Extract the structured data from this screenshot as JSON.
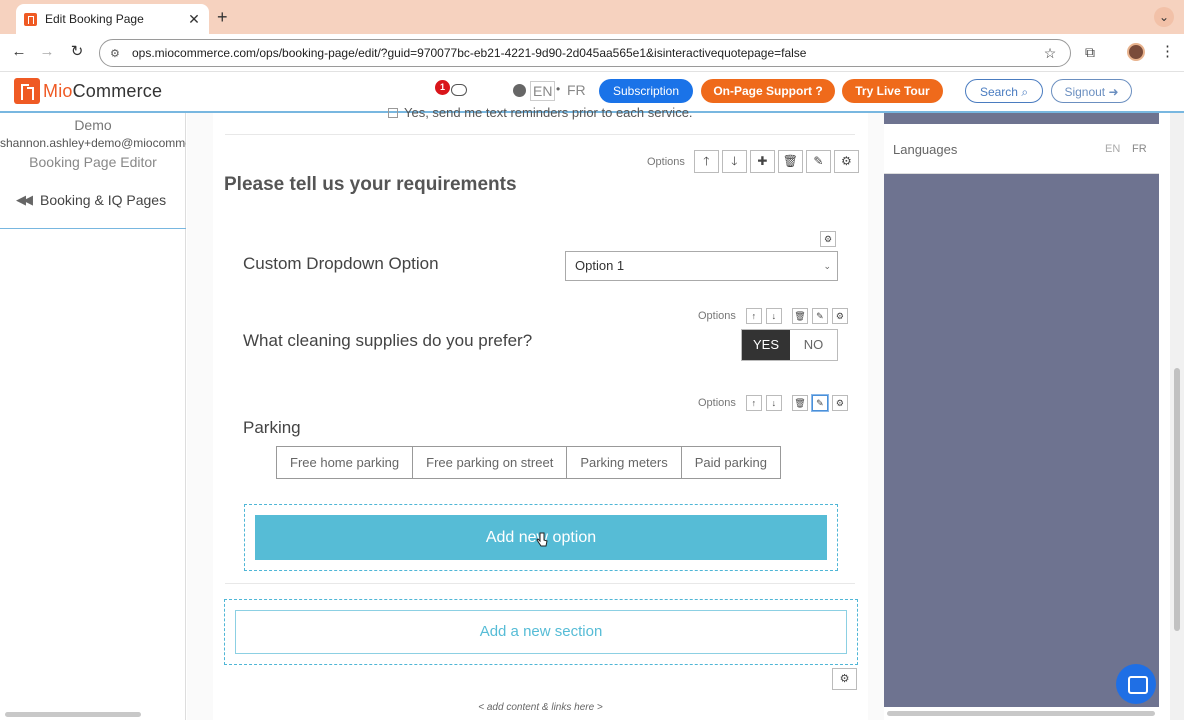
{
  "browser": {
    "tab_title": "Edit Booking Page",
    "tab_close": "✕",
    "new_tab": "+",
    "tab_menu": "⌄",
    "back": "←",
    "forward": "→",
    "reload": "↻",
    "url": "ops.miocommerce.com/ops/booking-page/edit/?guid=970077bc-eb21-4221-9d90-2d045aa565e1&isinteractivequotepage=false",
    "star": "☆",
    "kebab": "⋮"
  },
  "header": {
    "logo_mio": "Mio",
    "logo_commerce": "Commerce",
    "notification_count": "1",
    "lang_en": "EN",
    "lang_dot": "•",
    "lang_fr": "FR",
    "subscription": "Subscription",
    "support": "On-Page Support ?",
    "live_tour": "Try Live Tour",
    "search": "Search",
    "signout": "Signout"
  },
  "sidebar": {
    "account": "Demo",
    "email": "shannon.ashley+demo@miocommerce.com",
    "role": "Booking Page Editor",
    "back_link": "Booking & IQ Pages"
  },
  "main": {
    "prev_checkbox_text": "Yes, send me text reminders prior to each service.",
    "options_label": "Options",
    "section_title": "Please tell us your requirements",
    "dropdown_label": "Custom Dropdown Option",
    "dropdown_value": "Option 1",
    "question_label": "What cleaning supplies do you prefer?",
    "yes": "YES",
    "no": "NO",
    "parking_label": "Parking",
    "parking_options": [
      "Free home parking",
      "Free parking on street",
      "Parking meters",
      "Paid parking"
    ],
    "add_option": "Add new option",
    "add_section": "Add a new section",
    "hint": "< add content & links here >"
  },
  "right_panel": {
    "languages": "Languages",
    "en": "EN",
    "fr": "FR"
  }
}
